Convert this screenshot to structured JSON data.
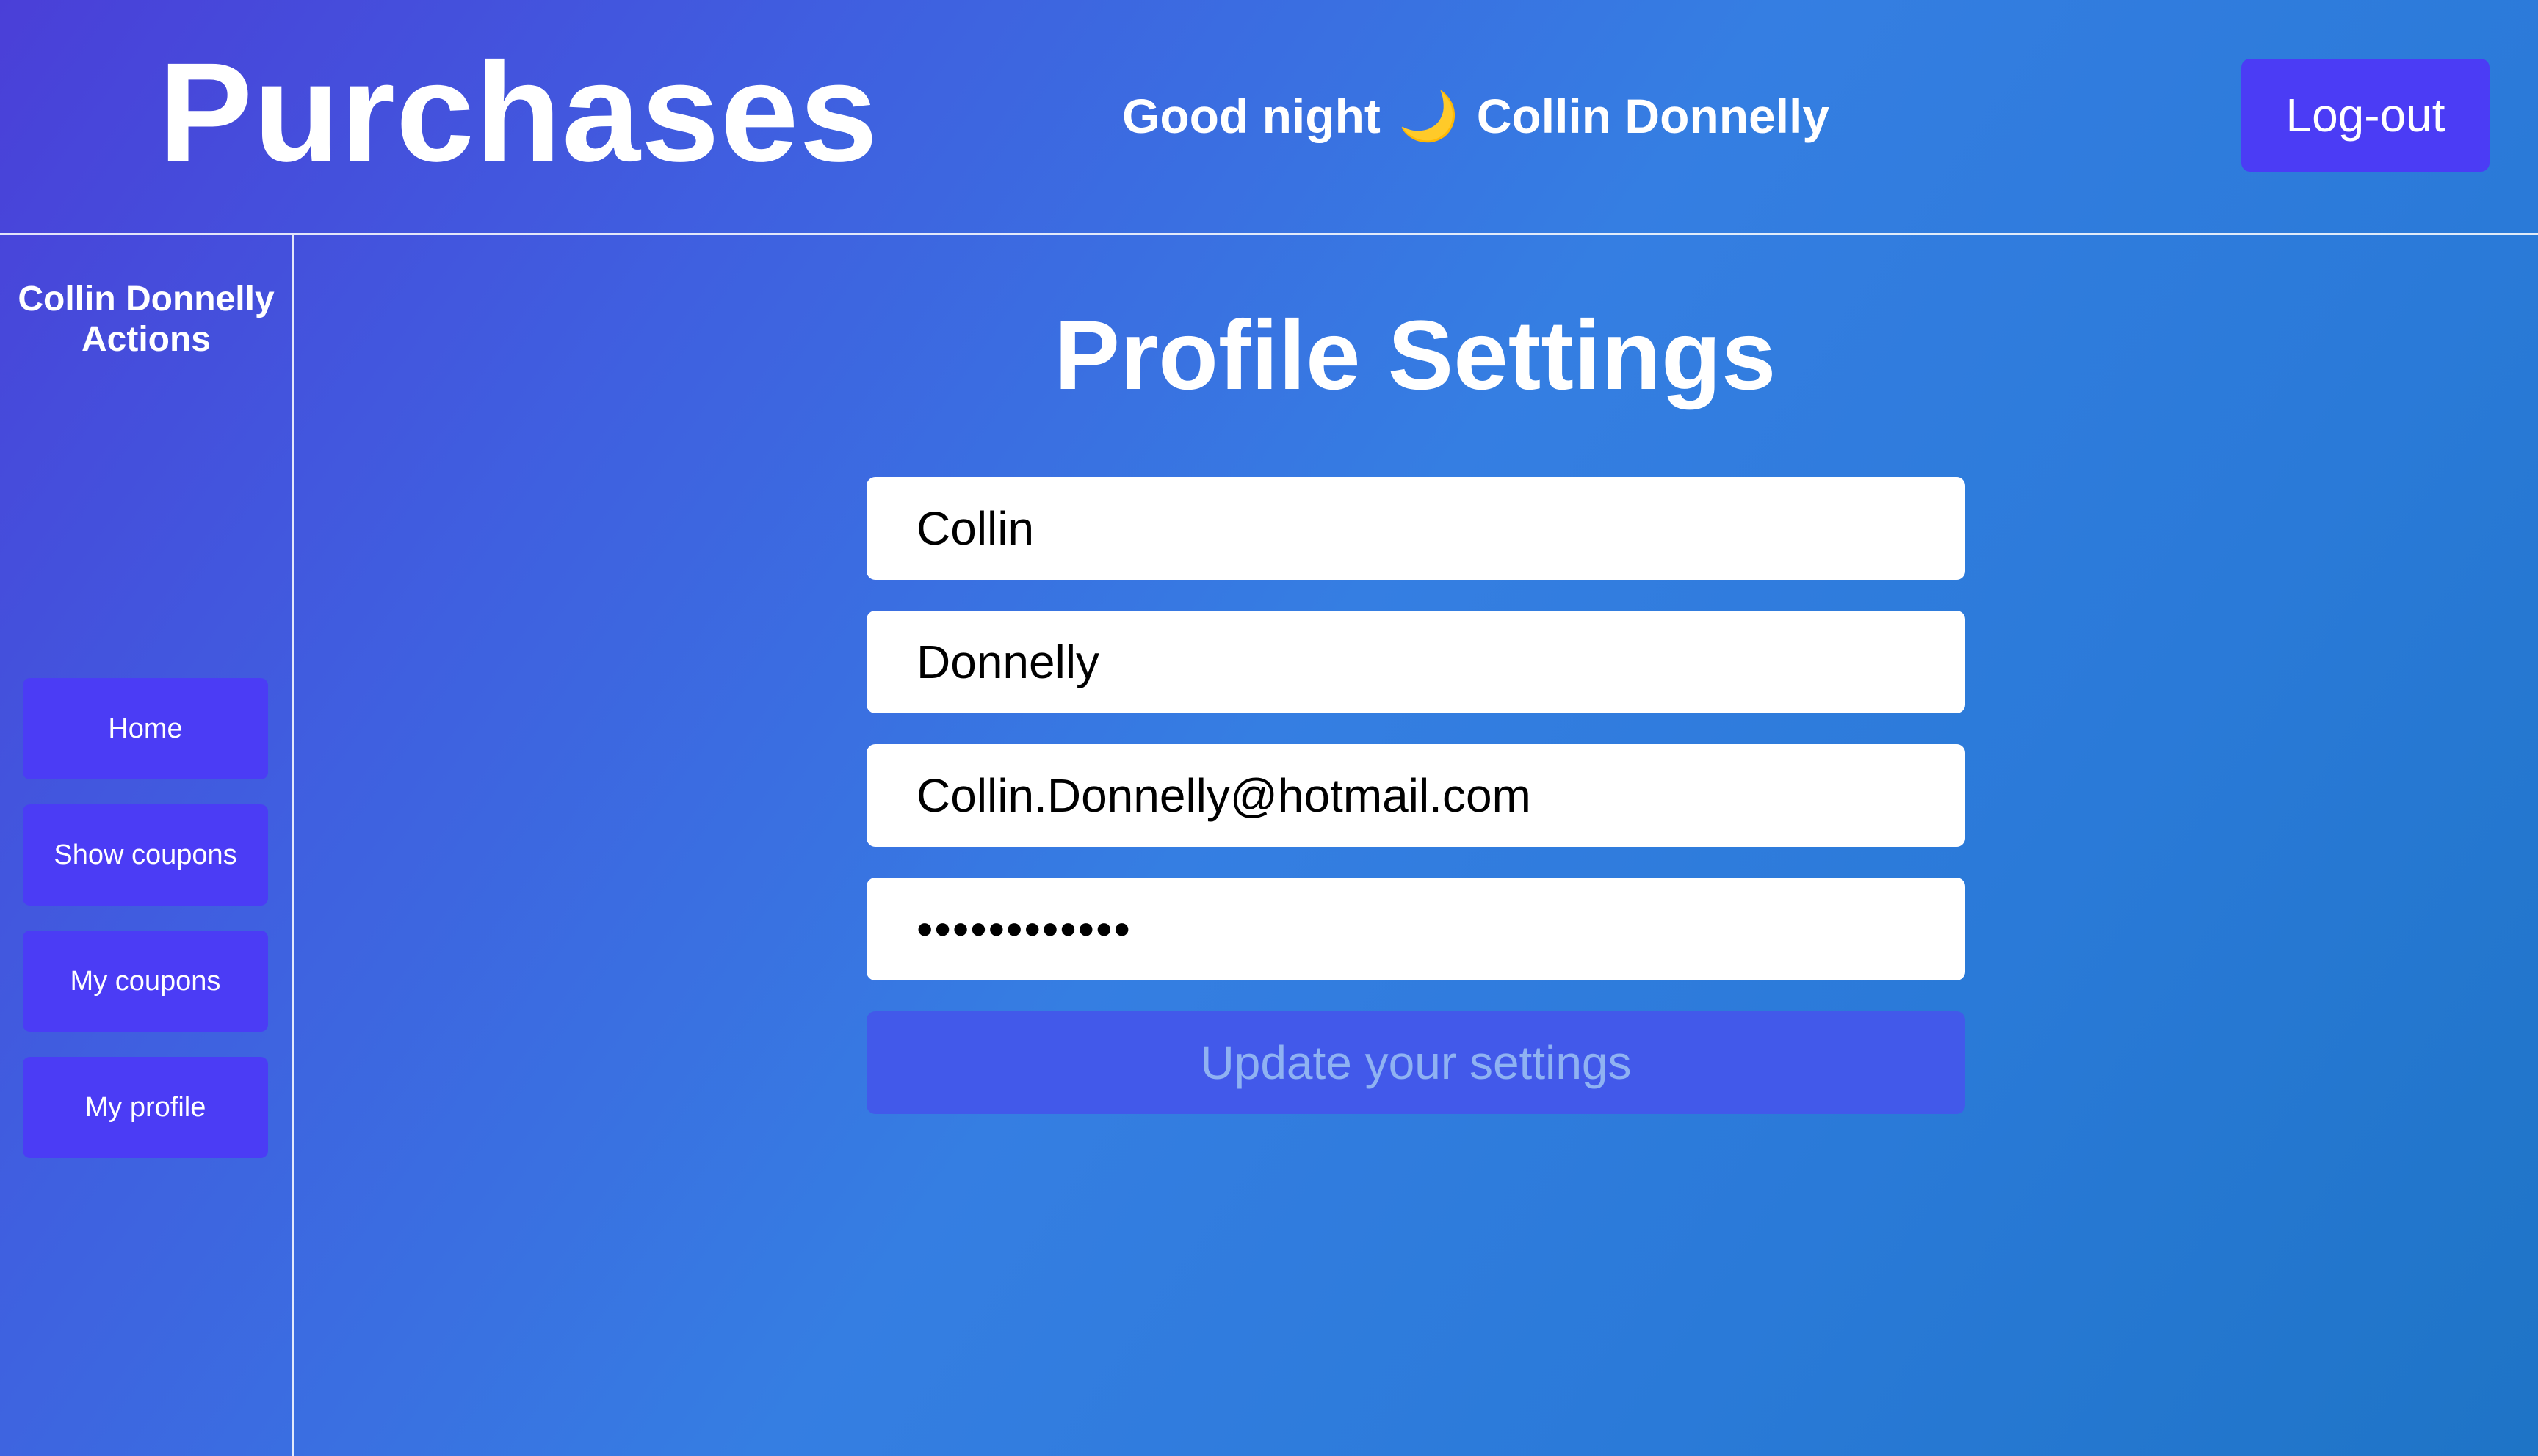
{
  "header": {
    "app_title": "Purchases",
    "greeting_prefix": "Good night",
    "greeting_icon": "🌙",
    "user_name": "Collin Donnelly",
    "logout_label": "Log-out"
  },
  "sidebar": {
    "title": "Collin Donnelly Actions",
    "items": [
      {
        "label": "Home"
      },
      {
        "label": "Show coupons"
      },
      {
        "label": "My coupons"
      },
      {
        "label": "My profile"
      }
    ]
  },
  "main": {
    "title": "Profile Settings",
    "form": {
      "first_name": "Collin",
      "last_name": "Donnelly",
      "email": "Collin.Donnelly@hotmail.com",
      "password": "............",
      "submit_label": "Update your settings"
    }
  },
  "colors": {
    "button": "#4b3cf5",
    "disabled_button": "#4259ea",
    "disabled_text": "#8fb2f2",
    "moon": "#ffd23f"
  }
}
